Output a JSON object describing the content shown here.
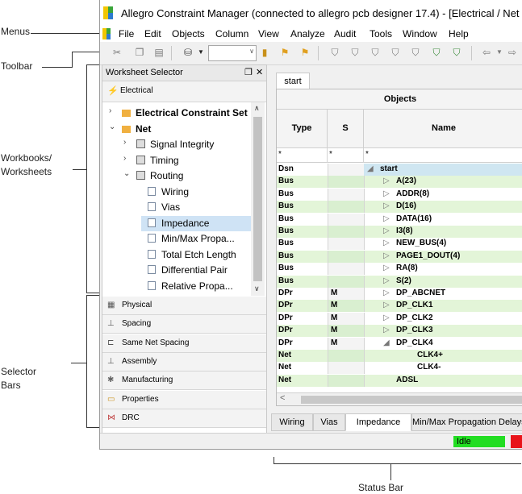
{
  "annotations": {
    "menus": "Menus",
    "toolbar": "Toolbar",
    "workbooks_line1": "Workbooks/",
    "workbooks_line2": "Worksheets",
    "selector_line1": "Selector",
    "selector_line2": "Bars",
    "status_bar": "Status Bar"
  },
  "window": {
    "title": "Allegro Constraint Manager (connected to allegro pcb designer 17.4) - [Electrical / Net / Routing"
  },
  "menu": [
    "File",
    "Edit",
    "Objects",
    "Column",
    "View",
    "Analyze",
    "Audit",
    "Tools",
    "Window",
    "Help"
  ],
  "worksheet_selector": {
    "title": "Worksheet Selector",
    "pin": "❐",
    "close": "✕",
    "electrical_bar": "Electrical",
    "tree": [
      {
        "label": "Electrical Constraint Set",
        "bold": true,
        "arrow": "›"
      },
      {
        "label": "Net",
        "bold": true,
        "arrow": "⌄"
      },
      {
        "label": "Signal Integrity",
        "arrow": "›"
      },
      {
        "label": "Timing",
        "arrow": "›"
      },
      {
        "label": "Routing",
        "arrow": "⌄"
      },
      {
        "label": "Wiring"
      },
      {
        "label": "Vias"
      },
      {
        "label": "Impedance",
        "selected": true
      },
      {
        "label": "Min/Max Propa..."
      },
      {
        "label": "Total Etch Length"
      },
      {
        "label": "Differential Pair"
      },
      {
        "label": "Relative Propa..."
      }
    ],
    "selector_bars": [
      "Physical",
      "Spacing",
      "Same Net Spacing",
      "Assembly",
      "Manufacturing",
      "Properties",
      "DRC"
    ]
  },
  "worksheet": {
    "tab": "start",
    "objects_header": "Objects",
    "columns": [
      "Type",
      "S",
      "Name"
    ],
    "filter": [
      "*",
      "*",
      "*"
    ],
    "rows": [
      {
        "type": "Dsn",
        "s": "",
        "name": "start",
        "tri": "◢",
        "indent": 0,
        "style": "dsn"
      },
      {
        "type": "Bus",
        "s": "",
        "name": "A(23)",
        "tri": "▷",
        "indent": 1,
        "style": "green"
      },
      {
        "type": "Bus",
        "s": "",
        "name": "ADDR(8)",
        "tri": "▷",
        "indent": 1,
        "style": "white"
      },
      {
        "type": "Bus",
        "s": "",
        "name": "D(16)",
        "tri": "▷",
        "indent": 1,
        "style": "green"
      },
      {
        "type": "Bus",
        "s": "",
        "name": "DATA(16)",
        "tri": "▷",
        "indent": 1,
        "style": "white"
      },
      {
        "type": "Bus",
        "s": "",
        "name": "I3(8)",
        "tri": "▷",
        "indent": 1,
        "style": "green"
      },
      {
        "type": "Bus",
        "s": "",
        "name": "NEW_BUS(4)",
        "tri": "▷",
        "indent": 1,
        "style": "white"
      },
      {
        "type": "Bus",
        "s": "",
        "name": "PAGE1_DOUT(4)",
        "tri": "▷",
        "indent": 1,
        "style": "green"
      },
      {
        "type": "Bus",
        "s": "",
        "name": "RA(8)",
        "tri": "▷",
        "indent": 1,
        "style": "white"
      },
      {
        "type": "Bus",
        "s": "",
        "name": "S(2)",
        "tri": "▷",
        "indent": 1,
        "style": "green"
      },
      {
        "type": "DPr",
        "s": "M",
        "name": "DP_ABCNET",
        "tri": "▷",
        "indent": 1,
        "style": "white"
      },
      {
        "type": "DPr",
        "s": "M",
        "name": "DP_CLK1",
        "tri": "▷",
        "indent": 1,
        "style": "green"
      },
      {
        "type": "DPr",
        "s": "M",
        "name": "DP_CLK2",
        "tri": "▷",
        "indent": 1,
        "style": "white"
      },
      {
        "type": "DPr",
        "s": "M",
        "name": "DP_CLK3",
        "tri": "▷",
        "indent": 1,
        "style": "green"
      },
      {
        "type": "DPr",
        "s": "M",
        "name": "DP_CLK4",
        "tri": "◢",
        "indent": 1,
        "style": "white"
      },
      {
        "type": "Net",
        "s": "",
        "name": "CLK4+",
        "tri": "",
        "indent": 2,
        "style": "green"
      },
      {
        "type": "Net",
        "s": "",
        "name": "CLK4-",
        "tri": "",
        "indent": 2,
        "style": "white"
      },
      {
        "type": "Net",
        "s": "",
        "name": "ADSL",
        "tri": "",
        "indent": 1,
        "style": "green"
      }
    ],
    "bottom_tabs": [
      "Wiring",
      "Vias",
      "Impedance",
      "Min/Max Propagation Delays"
    ],
    "active_tab": "Impedance"
  },
  "status": {
    "text": "Idle",
    "idle_color": "#22dd22",
    "alert_color": "#e8141a"
  },
  "colors": {
    "row_green": "#e3f5d8",
    "row_dsn": "#cfe6f1",
    "selected_item": "#cfe3f5"
  }
}
